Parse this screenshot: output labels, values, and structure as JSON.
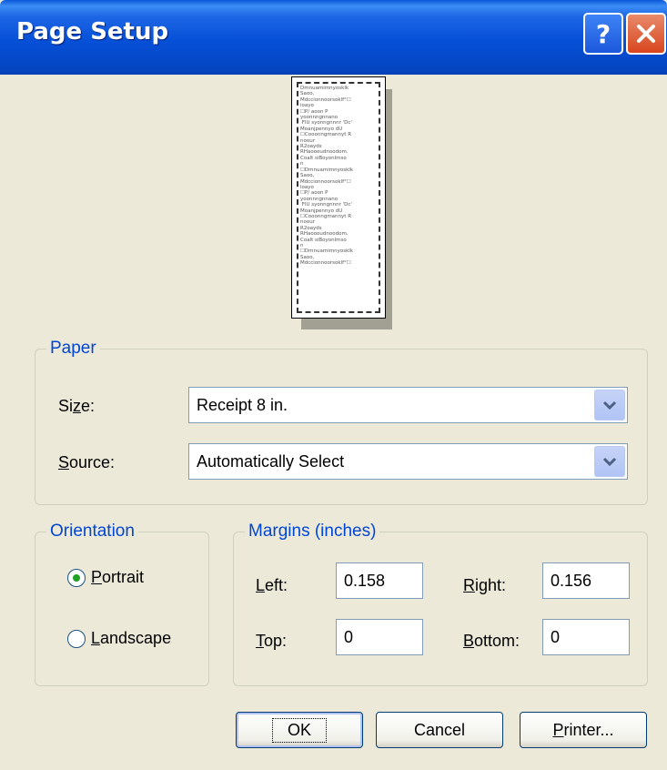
{
  "window": {
    "title": "Page Setup",
    "help_glyph": "?",
    "close_icon": "close-icon"
  },
  "preview": {
    "text": "Dmnuamimnyosklk\nSaoo,\nMdccionnoorsoklf°☐\nioayo\n☐P/ aoon P\nyoonnngnnano\n FlU syonngnnnr 'Dc'\nMoanjpennyo dU\n☐Cooonngmannyt R\nnoour\nR2oayds\nRHaoooudnoodom.\nCoalt siBoyonlmso\nn\n☐Dmnuamimnyosklk\nSaoo,\nMdccionnoorsoklf°☐\nioayo\n☐P/ aoon P\nyoonnngnnano\n FlU syonngnnnr 'Dc'\nMoanjpennyo dU\n☐Cooonngmannyt R\nnoour\nR2oayds\nRHaoooudnoodom.\nCoalt siBoyonlmso\nn\n☐Dmnuamimnyosklk\nSaoo,\nMdccionnoorsoklf°☐"
  },
  "paper": {
    "legend": "Paper",
    "size_label": {
      "pre": "Si",
      "key": "z",
      "post": "e:"
    },
    "size_value": "Receipt 8 in.",
    "source_label": {
      "pre": "",
      "key": "S",
      "post": "ource:"
    },
    "source_value": "Automatically Select"
  },
  "orientation": {
    "legend": "Orientation",
    "portrait": {
      "pre": "",
      "key": "P",
      "post": "ortrait",
      "selected": true
    },
    "landscape": {
      "pre": "",
      "key": "L",
      "post": "andscape",
      "selected": false
    }
  },
  "margins": {
    "legend": "Margins (inches)",
    "left_label": {
      "pre": "",
      "key": "L",
      "post": "eft:"
    },
    "left_value": "0.158",
    "right_label": {
      "pre": "",
      "key": "R",
      "post": "ight:"
    },
    "right_value": "0.156",
    "top_label": {
      "pre": "",
      "key": "T",
      "post": "op:"
    },
    "top_value": "0",
    "bottom_label": {
      "pre": "",
      "key": "B",
      "post": "ottom:"
    },
    "bottom_value": "0"
  },
  "buttons": {
    "ok": "OK",
    "cancel": "Cancel",
    "printer": {
      "pre": "",
      "key": "P",
      "post": "rinter..."
    }
  },
  "colors": {
    "titlebar": "#0650D8",
    "face": "#ECE9D8",
    "group_title": "#0046D5",
    "radio_dot": "#21A121"
  }
}
